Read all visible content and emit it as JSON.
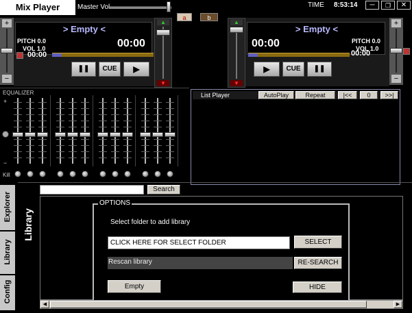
{
  "app": {
    "title": "Mix Player",
    "master_vol_label": "Master Vol",
    "time_label": "TIME",
    "time_value": "8:53:14"
  },
  "window_controls": {
    "minimize": "─",
    "restore": "❐",
    "close": "✕"
  },
  "crossfader": {
    "a": "a",
    "b": "b"
  },
  "deck_left": {
    "track": "> Empty <",
    "pitch": "PITCH 0.0",
    "vol": "VOL 1.0",
    "elapsed": "00:00",
    "remaining": "00:00",
    "pause": "❚❚",
    "cue": "CUE",
    "play": "▶"
  },
  "deck_right": {
    "track": "> Empty <",
    "pitch": "PITCH 0.0",
    "vol": "VOL 1.0",
    "elapsed": "00:00",
    "remaining": "00:00",
    "pause": "❚❚",
    "cue": "CUE",
    "play": "▶"
  },
  "equalizer": {
    "label": "EQUALIZER",
    "plus": "+",
    "minus": "−",
    "kill_label": "Kill"
  },
  "list_player": {
    "title": "List Player",
    "autoplay": "AutoPlay",
    "repeat": "Repeat",
    "prev": "|<<",
    "counter": "0",
    "next": ">>|"
  },
  "search": {
    "value": "",
    "button": "Search"
  },
  "tabs": {
    "explorer": "Explorer",
    "library": "Library",
    "config": "Config"
  },
  "library_heading": "Library",
  "options": {
    "title": "OPTIONS",
    "instruction": "Select folder to add library",
    "folder_field": "CLICK HERE FOR SELECT FOLDER",
    "select_button": "SELECT",
    "rescan_label": "Rescan library",
    "research_button": "RE-SEARCH",
    "empty_button": "Empty",
    "hide_button": "HIDE"
  },
  "scrollbar": {
    "left": "◀",
    "right": "▶"
  }
}
